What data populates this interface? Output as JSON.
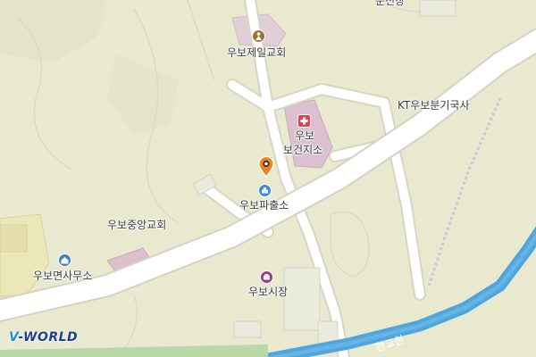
{
  "map": {
    "labels": {
      "church_jeil": "우보제일교회",
      "health_center_line1": "우보",
      "health_center_line2": "보건지소",
      "kt_office": "KT우보분기국사",
      "police": "우보파출소",
      "church_jungang": "우보중앙교회",
      "township_office": "우보면사무소",
      "market": "우보시장",
      "top_partial": "운전장",
      "stream": "한교천"
    },
    "brand": {
      "prefix": "V",
      "name": "-WORLD"
    },
    "icons": {
      "church": "church-icon",
      "hospital": "hospital-cross-icon",
      "police": "police-icon",
      "office": "government-office-icon",
      "market": "market-icon",
      "marker": "location-pin-icon"
    },
    "colors": {
      "land": "#e8e9cf",
      "road": "#ffffff",
      "road_outline": "#d7d6c6",
      "stream": "#4fa6de",
      "building_pink": "#d8bccb",
      "hospital_red": "#e0424f",
      "church_brown": "#a0713b",
      "police_blue": "#3a8ee0",
      "office_blue": "#3b7fc4",
      "market_purple": "#9a3c86",
      "marker_orange": "#e88521",
      "rail": "#b9b9c9"
    }
  }
}
